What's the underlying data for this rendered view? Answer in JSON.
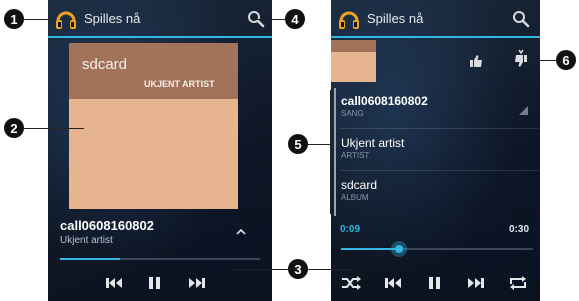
{
  "left_screen": {
    "header": {
      "title": "Spilles nå"
    },
    "album_art": {
      "title": "sdcard",
      "subtitle": "UKJENT ARTIST"
    },
    "now_playing": {
      "title": "call0608160802",
      "artist": "Ukjent artist"
    },
    "progress_fraction": 0.3
  },
  "right_screen": {
    "header": {
      "title": "Spilles nå"
    },
    "rows": [
      {
        "title": "call0608160802",
        "label": "SANG"
      },
      {
        "title": "Ukjent artist",
        "label": "ARTIST"
      },
      {
        "title": "sdcard",
        "label": "ALBUM"
      }
    ],
    "time_elapsed": "0:09",
    "time_total": "0:30",
    "progress_fraction": 0.3
  },
  "callouts": [
    "1",
    "2",
    "3",
    "4",
    "5",
    "6"
  ],
  "icons": [
    "headphones-icon",
    "search-icon",
    "chevron-up-icon",
    "previous-icon",
    "pause-icon",
    "next-icon",
    "shuffle-icon",
    "repeat-icon",
    "thumbs-up-icon",
    "thumbs-down-icon",
    "expand-corner-icon"
  ],
  "colors": {
    "accent": "#33b5e5",
    "art_top": "#a2735a",
    "art_bottom": "#e6b48e"
  }
}
